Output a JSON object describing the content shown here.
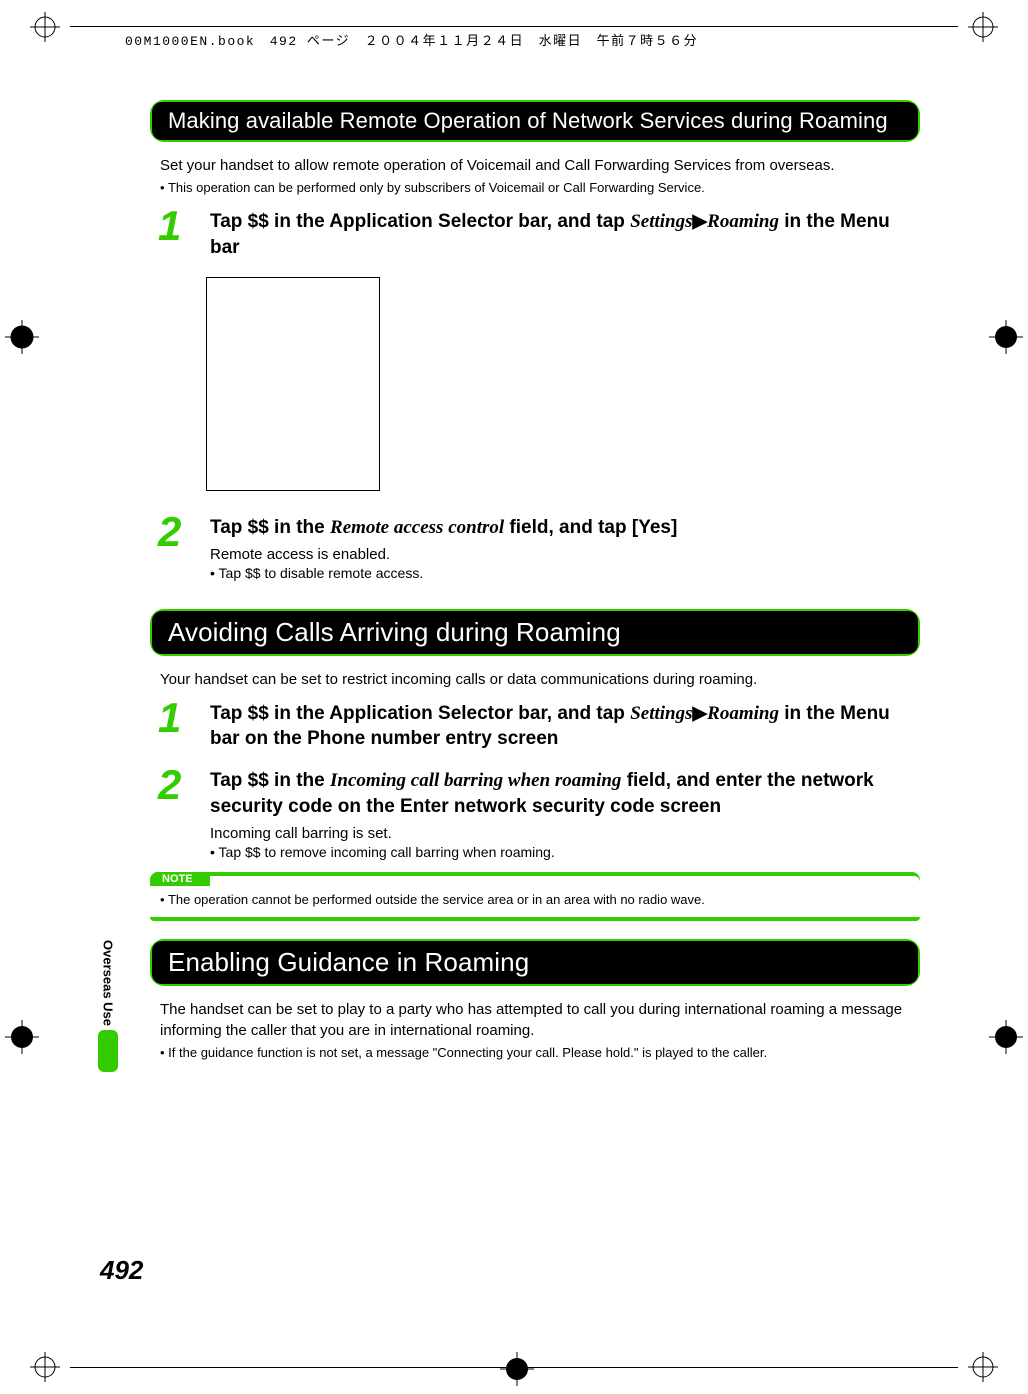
{
  "header": {
    "book_info": "00M1000EN.book　492 ページ　２００４年１１月２４日　水曜日　午前７時５６分"
  },
  "side_tab": "Overseas Use",
  "page_number": "492",
  "sections": [
    {
      "heading": "Making available Remote Operation of Network Services during Roaming",
      "intro": "Set your handset to allow remote operation of Voicemail and Call Forwarding Services from overseas.",
      "intro_bullet": "This operation can be performed only by subscribers of Voicemail or Call Forwarding Service.",
      "steps": [
        {
          "num": "1",
          "title_pre": "Tap $$ in the Application Selector bar, and tap ",
          "title_italic1": "Settings",
          "title_mid": " ▶ ",
          "title_italic2": "Roaming",
          "title_post": " in the Menu bar",
          "sub": "",
          "bullets": []
        },
        {
          "num": "2",
          "title_pre": "Tap $$ in the ",
          "title_italic1": "Remote access control",
          "title_mid": "",
          "title_italic2": "",
          "title_post": " field, and tap [Yes]",
          "sub": "Remote access is enabled.",
          "bullets": [
            "Tap $$ to disable remote access."
          ]
        }
      ]
    },
    {
      "heading": "Avoiding Calls Arriving during Roaming",
      "intro": "Your handset can be set to restrict incoming calls or data communications during roaming.",
      "intro_bullet": "",
      "steps": [
        {
          "num": "1",
          "title_pre": "Tap $$ in the Application Selector bar, and tap ",
          "title_italic1": "Settings",
          "title_mid": " ▶ ",
          "title_italic2": "Roaming",
          "title_post": " in the Menu bar on the Phone number entry screen",
          "sub": "",
          "bullets": []
        },
        {
          "num": "2",
          "title_pre": "Tap $$ in the ",
          "title_italic1": "Incoming call barring when roaming",
          "title_mid": "",
          "title_italic2": "",
          "title_post": " field, and enter the network security code on the Enter network security code screen",
          "sub": "Incoming call barring is set.",
          "bullets": [
            "Tap $$ to remove incoming call barring when roaming."
          ]
        }
      ],
      "note": {
        "label": "NOTE",
        "text": "The operation cannot be performed outside the service area or in an area with no radio wave."
      }
    },
    {
      "heading": "Enabling Guidance in Roaming",
      "intro": "The handset can be set to play to a party who has attempted to call you during international roaming a message informing the caller that you are in international roaming.",
      "intro_bullet": "If the guidance function is not set, a message \"Connecting your call. Please hold.\" is played to the caller.",
      "steps": []
    }
  ]
}
